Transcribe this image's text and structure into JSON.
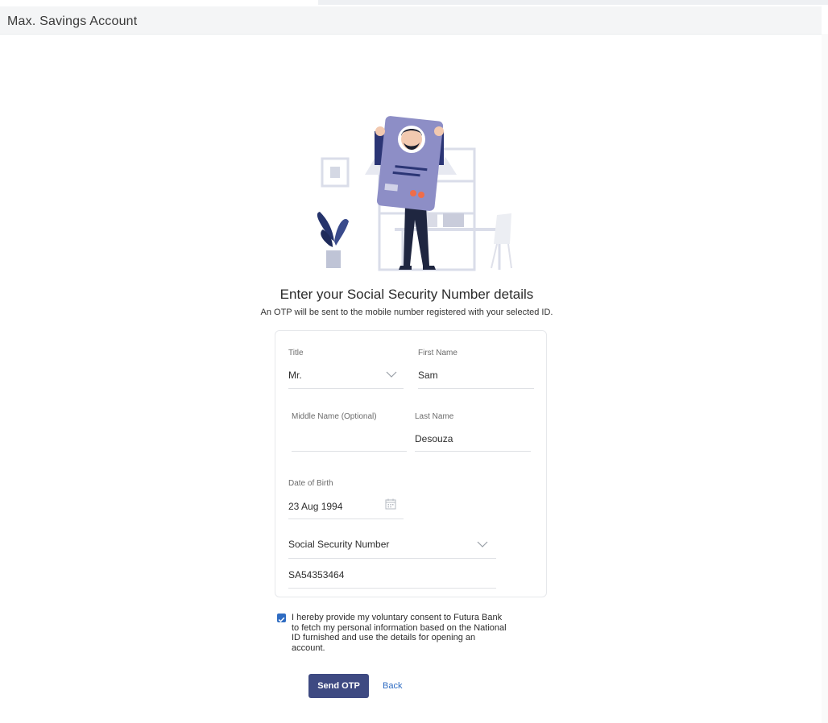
{
  "header": {
    "title": "Max. Savings Account"
  },
  "intro": {
    "heading": "Enter your Social Security Number details",
    "subheading": "An OTP will be sent to the mobile number registered with your selected ID."
  },
  "form": {
    "title": {
      "label": "Title",
      "value": "Mr."
    },
    "first_name": {
      "label": "First Name",
      "value": "Sam"
    },
    "middle_name": {
      "label": "Middle Name (Optional)",
      "value": ""
    },
    "last_name": {
      "label": "Last Name",
      "value": "Desouza"
    },
    "dob": {
      "label": "Date of Birth",
      "value": "23 Aug 1994"
    },
    "id_type": {
      "value": "Social Security Number"
    },
    "id_number": {
      "value": "SA54353464"
    }
  },
  "consent": {
    "checked": true,
    "text": "I hereby provide my voluntary consent to Futura Bank to fetch my personal information based on the National ID furnished and use the details for opening an account."
  },
  "actions": {
    "send_otp": "Send OTP",
    "back": "Back"
  },
  "colors": {
    "primary": "#3e4a82",
    "link": "#2f6cc2",
    "accent": "#ef6d4a"
  },
  "icons": {
    "dropdown": "chevron-down-icon",
    "calendar": "calendar-icon",
    "check": "checkmark-icon"
  }
}
